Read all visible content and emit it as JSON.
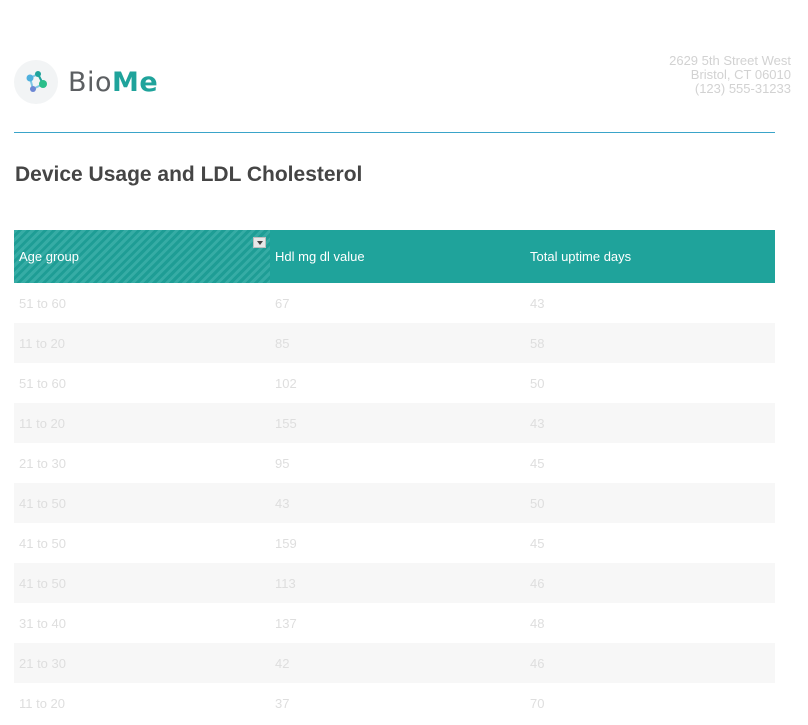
{
  "brand": {
    "name_part1": "Bio",
    "name_part2": "Me",
    "accent_color": "#1fa39b",
    "icon": "molecule-icon"
  },
  "address": {
    "line1": "2629 5th Street West",
    "line2": "Bristol, CT 06010",
    "line3": "(123) 555-31233"
  },
  "report": {
    "title": "Device Usage and LDL Cholesterol"
  },
  "table": {
    "header_color": "#1fa39b",
    "columns": [
      "Age group",
      "Hdl mg dl value",
      "Total uptime days"
    ],
    "sort_icon": "dropdown-arrow-icon",
    "rows": [
      [
        "51 to 60",
        "67",
        "43"
      ],
      [
        "11 to 20",
        "85",
        "58"
      ],
      [
        "51 to 60",
        "102",
        "50"
      ],
      [
        "11 to 20",
        "155",
        "43"
      ],
      [
        "21 to 30",
        "95",
        "45"
      ],
      [
        "41 to 50",
        "43",
        "50"
      ],
      [
        "41 to 50",
        "159",
        "45"
      ],
      [
        "41 to 50",
        "113",
        "46"
      ],
      [
        "31 to 40",
        "137",
        "48"
      ],
      [
        "21 to 30",
        "42",
        "46"
      ],
      [
        "11 to 20",
        "37",
        "70"
      ]
    ]
  }
}
